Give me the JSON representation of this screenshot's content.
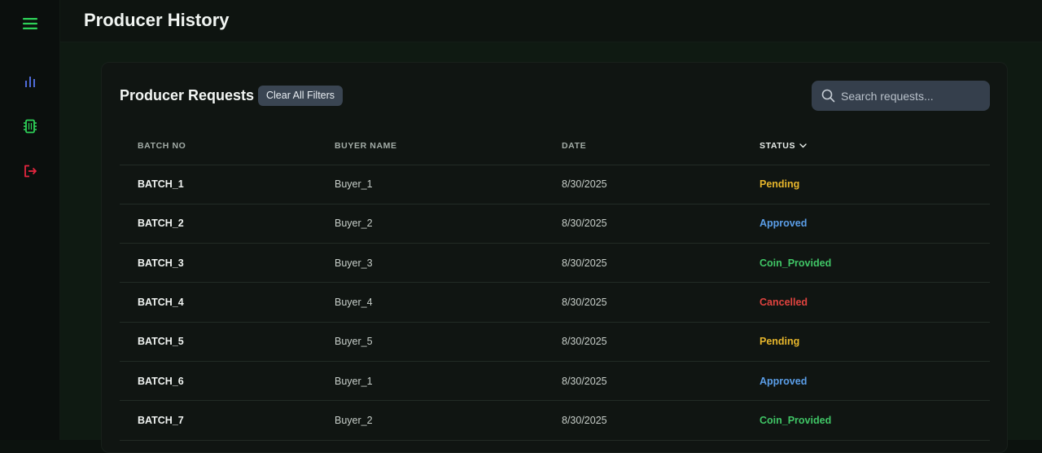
{
  "page": {
    "title": "Producer History"
  },
  "sidebar": {
    "items": [
      {
        "icon": "menu-icon",
        "color": "#2ed158"
      },
      {
        "icon": "bar-chart-icon",
        "color": "#4f6bd8"
      },
      {
        "icon": "chip-icon",
        "color": "#2ed158"
      },
      {
        "icon": "logout-icon",
        "color": "#e5263f"
      }
    ]
  },
  "card": {
    "title": "Producer Requests",
    "clear_filters_label": "Clear All Filters",
    "search": {
      "placeholder": "Search requests...",
      "value": ""
    }
  },
  "table": {
    "headers": {
      "batch": "BATCH NO",
      "buyer": "BUYER NAME",
      "date": "DATE",
      "status": "STATUS"
    },
    "status_colors": {
      "Pending": "#e7b62c",
      "Approved": "#5b9ee8",
      "Coin_Provided": "#40c666",
      "Cancelled": "#e0433f"
    },
    "rows": [
      {
        "batch": "BATCH_1",
        "buyer": "Buyer_1",
        "date": "8/30/2025",
        "status": "Pending"
      },
      {
        "batch": "BATCH_2",
        "buyer": "Buyer_2",
        "date": "8/30/2025",
        "status": "Approved"
      },
      {
        "batch": "BATCH_3",
        "buyer": "Buyer_3",
        "date": "8/30/2025",
        "status": "Coin_Provided"
      },
      {
        "batch": "BATCH_4",
        "buyer": "Buyer_4",
        "date": "8/30/2025",
        "status": "Cancelled"
      },
      {
        "batch": "BATCH_5",
        "buyer": "Buyer_5",
        "date": "8/30/2025",
        "status": "Pending"
      },
      {
        "batch": "BATCH_6",
        "buyer": "Buyer_1",
        "date": "8/30/2025",
        "status": "Approved"
      },
      {
        "batch": "BATCH_7",
        "buyer": "Buyer_2",
        "date": "8/30/2025",
        "status": "Coin_Provided"
      }
    ]
  }
}
